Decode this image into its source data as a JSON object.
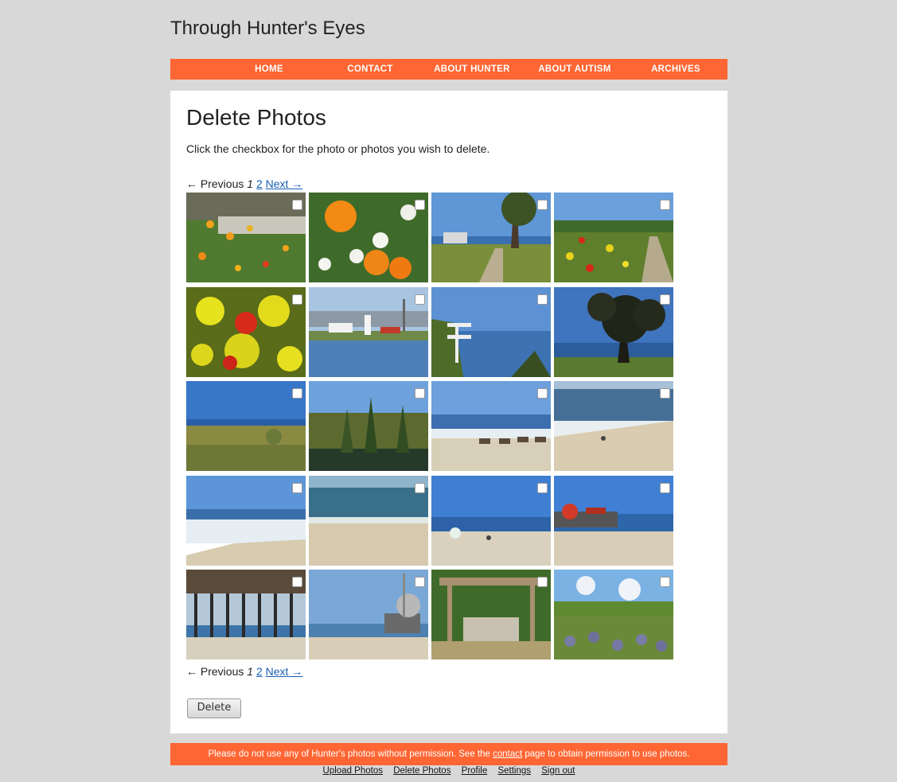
{
  "site": {
    "title": "Through Hunter's Eyes"
  },
  "nav": [
    {
      "label": "HOME"
    },
    {
      "label": "CONTACT"
    },
    {
      "label": "ABOUT HUNTER"
    },
    {
      "label": "ABOUT AUTISM"
    },
    {
      "label": "ARCHIVES"
    }
  ],
  "page": {
    "title": "Delete Photos",
    "intro": "Click the checkbox for the photo or photos you wish to delete."
  },
  "pager": {
    "prev": "← Previous",
    "current": "1",
    "next_page": "2",
    "next": "Next →"
  },
  "photos": [
    {
      "scene": "flowers-fence"
    },
    {
      "scene": "orange-poppies"
    },
    {
      "scene": "coastal-path-tree"
    },
    {
      "scene": "wildflowers-path"
    },
    {
      "scene": "yellow-red-flowers"
    },
    {
      "scene": "lighthouse"
    },
    {
      "scene": "bay-fence"
    },
    {
      "scene": "tree-silhouette-bay"
    },
    {
      "scene": "grassland-sea"
    },
    {
      "scene": "woods-creek"
    },
    {
      "scene": "beach-surf-rocks"
    },
    {
      "scene": "beach-bird"
    },
    {
      "scene": "waves-shore"
    },
    {
      "scene": "sandy-beach"
    },
    {
      "scene": "beach-people"
    },
    {
      "scene": "pier-rides"
    },
    {
      "scene": "pier-pilings"
    },
    {
      "scene": "boardwalk-rides"
    },
    {
      "scene": "pergola-garden"
    },
    {
      "scene": "lavender-field"
    }
  ],
  "delete_label": "Delete",
  "footer": {
    "before": "Please do not use any of Hunter's photos without permission. See the ",
    "link": "contact",
    "after": " page to obtain permission to use photos."
  },
  "admin_links": [
    "Upload Photos",
    "Delete Photos",
    "Profile",
    "Settings",
    "Sign out"
  ],
  "colors": {
    "accent": "#ff6633",
    "background": "#d8d8d8",
    "link": "#1a5fb4"
  }
}
